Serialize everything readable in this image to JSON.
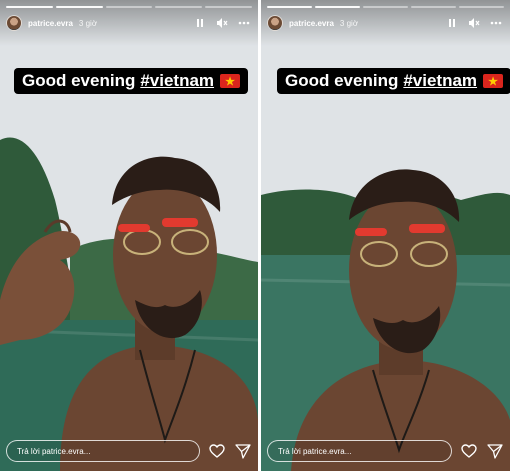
{
  "stories": [
    {
      "username": "patrice.evra",
      "time": "3 giờ",
      "caption_text": "Good evening",
      "caption_hashtag": "#vietnam",
      "flag_star": "★",
      "reply_placeholder": "Trả lời patrice.evra...",
      "progress_done": 2,
      "icons": [
        "pause-icon",
        "mute-icon",
        "more-icon",
        "heart-icon",
        "send-icon"
      ]
    },
    {
      "username": "patrice.evra",
      "time": "3 giờ",
      "caption_text": "Good evening",
      "caption_hashtag": "#vietnam",
      "flag_star": "★",
      "reply_placeholder": "Trả lời patrice.evra...",
      "progress_done": 2,
      "icons": [
        "pause-icon",
        "mute-icon",
        "more-icon",
        "heart-icon",
        "send-icon"
      ]
    }
  ],
  "colors": {
    "sky": "#dfe3e6",
    "mountain": "#2f5a3a",
    "water": "#2f6b58",
    "skin": "#6b4632",
    "flag_red": "#da251d",
    "flag_star": "#ffcd00"
  }
}
